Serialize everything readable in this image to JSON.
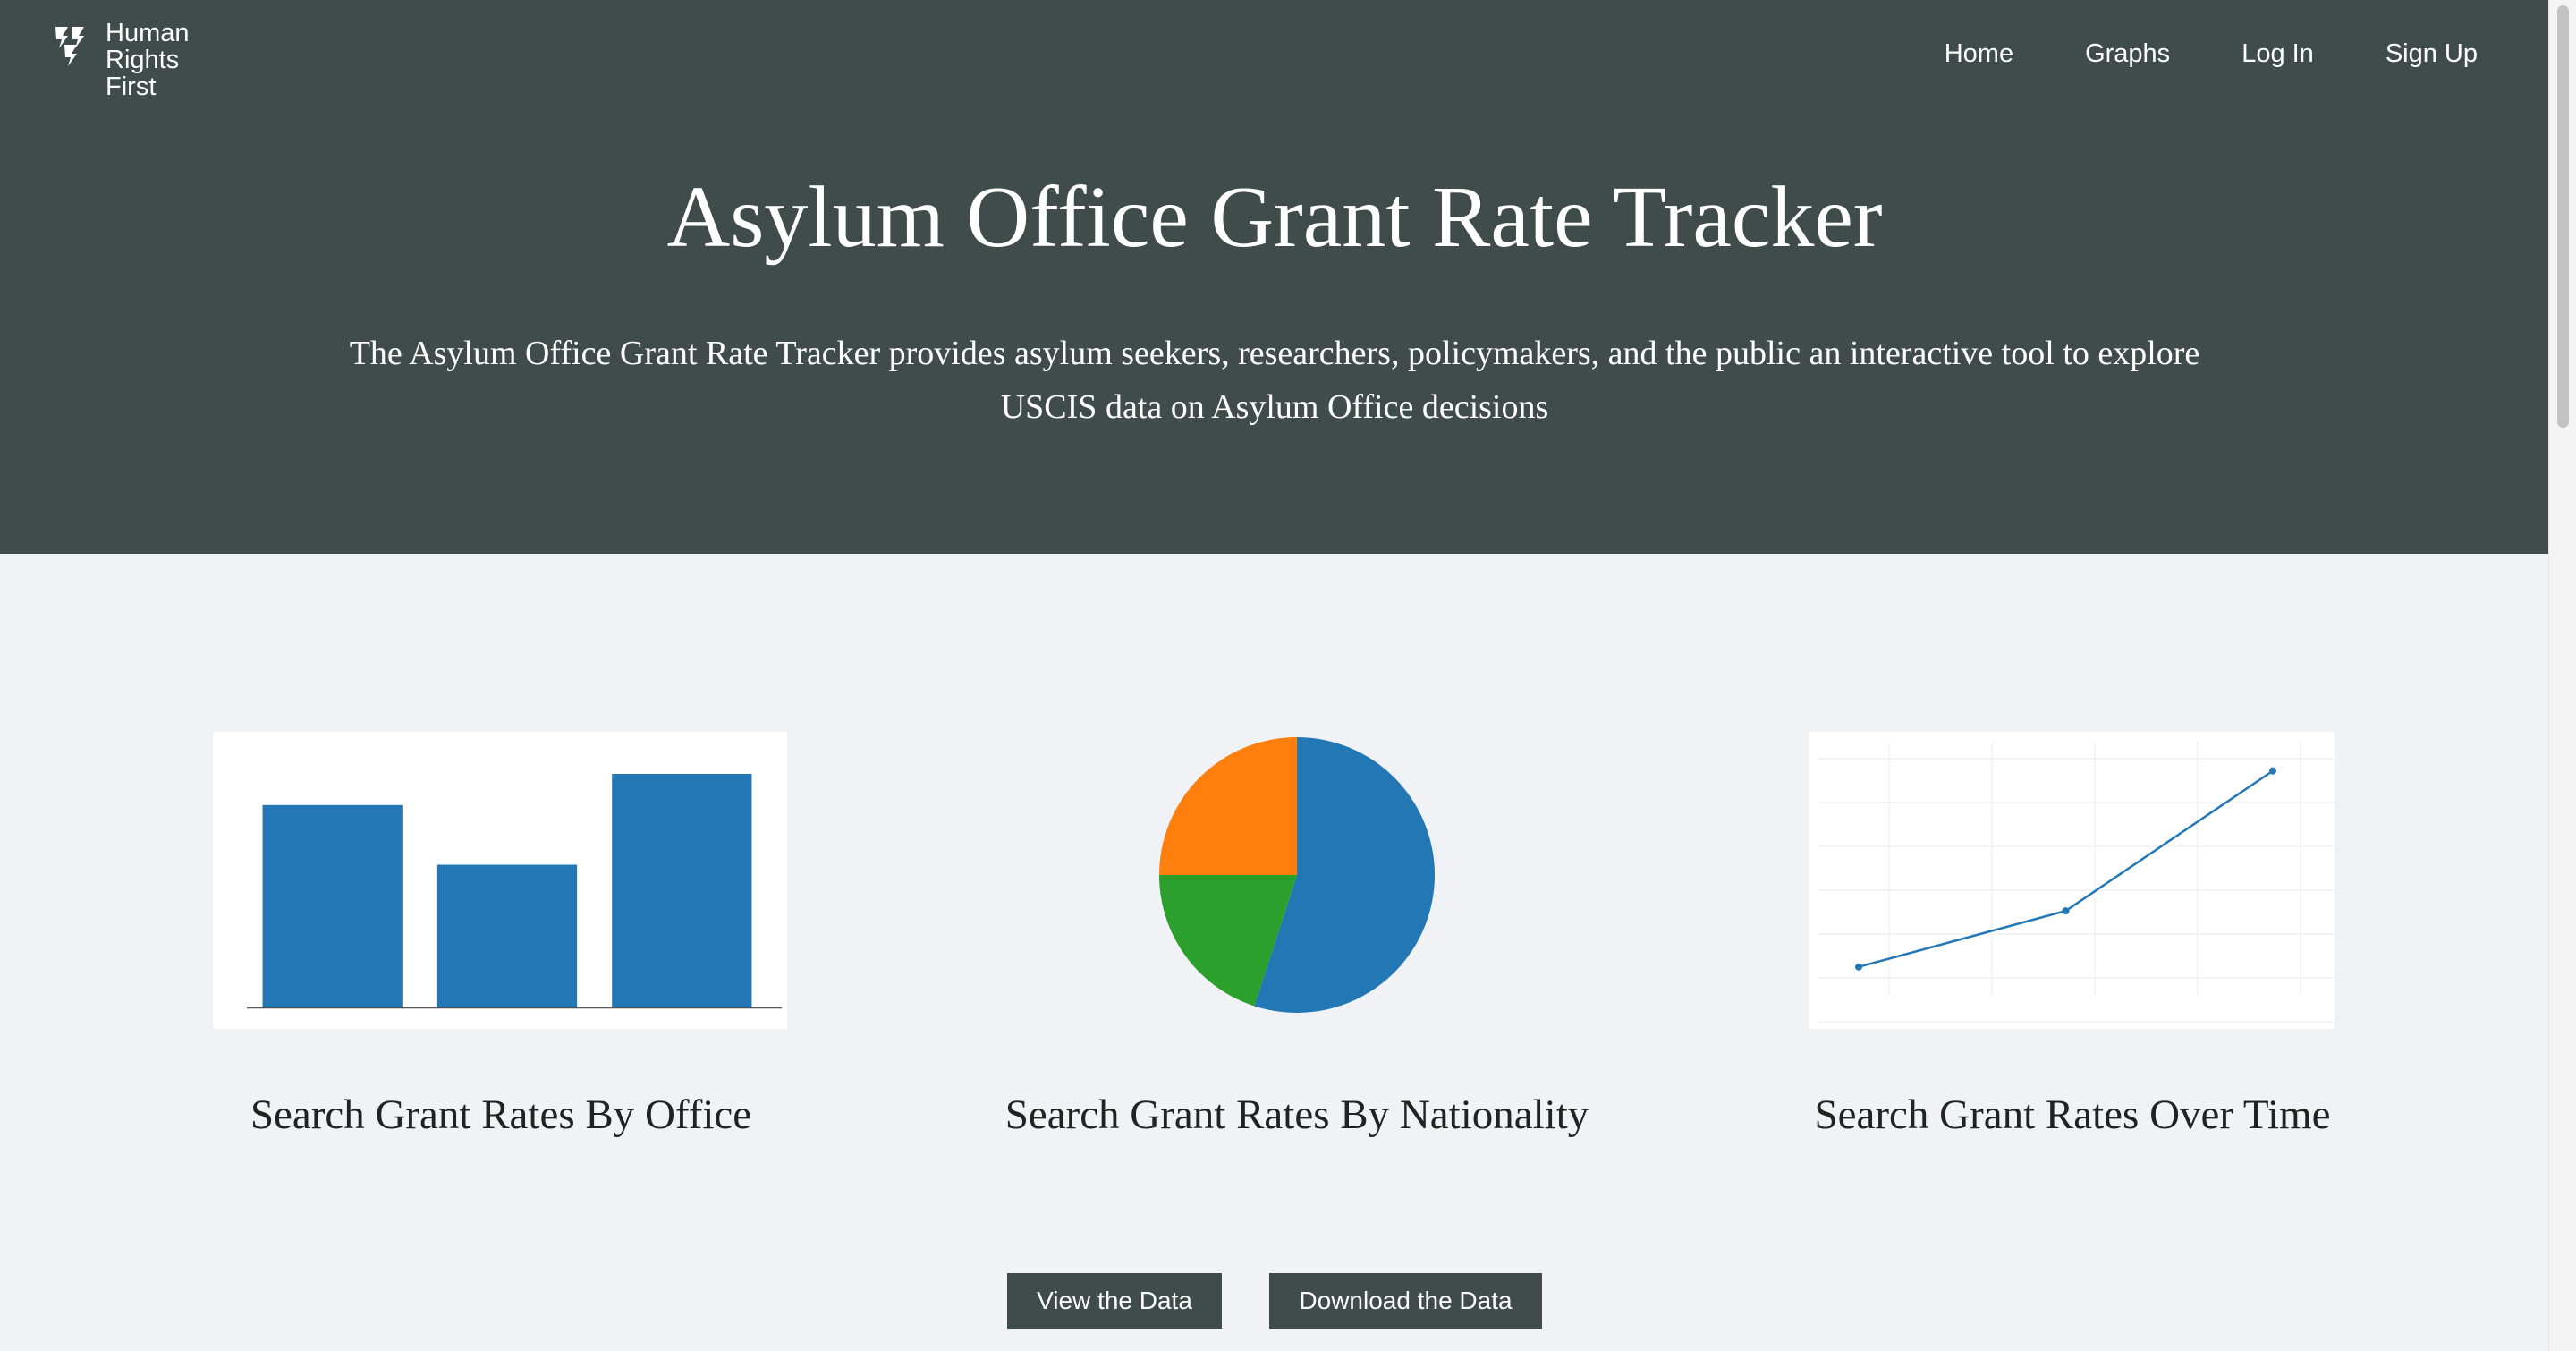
{
  "logo": {
    "line1": "Human",
    "line2": "Rights",
    "line3": "First"
  },
  "nav": {
    "items": [
      {
        "label": "Home"
      },
      {
        "label": "Graphs"
      },
      {
        "label": "Log In"
      },
      {
        "label": "Sign Up"
      }
    ]
  },
  "hero": {
    "title": "Asylum Office Grant Rate Tracker",
    "description": "The Asylum Office Grant Rate Tracker provides asylum seekers, researchers, policymakers, and the public an interactive tool to explore USCIS data on Asylum Office decisions"
  },
  "colors": {
    "header_bg": "#404c4b",
    "page_bg": "#f0f2f5",
    "chart_blue": "#2277b4",
    "chart_orange": "#ff7f0e",
    "chart_green": "#2ca02c"
  },
  "cards": [
    {
      "caption": "Search Grant Rates By Office",
      "icon": "bar-chart-thumbnail"
    },
    {
      "caption": "Search Grant Rates By Nationality",
      "icon": "pie-chart-thumbnail"
    },
    {
      "caption": "Search Grant Rates Over Time",
      "icon": "line-chart-thumbnail"
    }
  ],
  "buttons": {
    "view": "View the Data",
    "download": "Download the Data"
  },
  "chart_data": [
    {
      "type": "bar",
      "categories": [
        "",
        "",
        ""
      ],
      "values": [
        78,
        55,
        90
      ],
      "ylim": [
        0,
        100
      ],
      "grid": false
    },
    {
      "type": "pie",
      "values": [
        55,
        20,
        25
      ],
      "colors": [
        "#2277b4",
        "#2ca02c",
        "#ff7f0e"
      ]
    },
    {
      "type": "line",
      "x": [
        1,
        2,
        3
      ],
      "values": [
        10,
        30,
        80
      ],
      "ylim": [
        0,
        85
      ],
      "grid": true
    }
  ]
}
